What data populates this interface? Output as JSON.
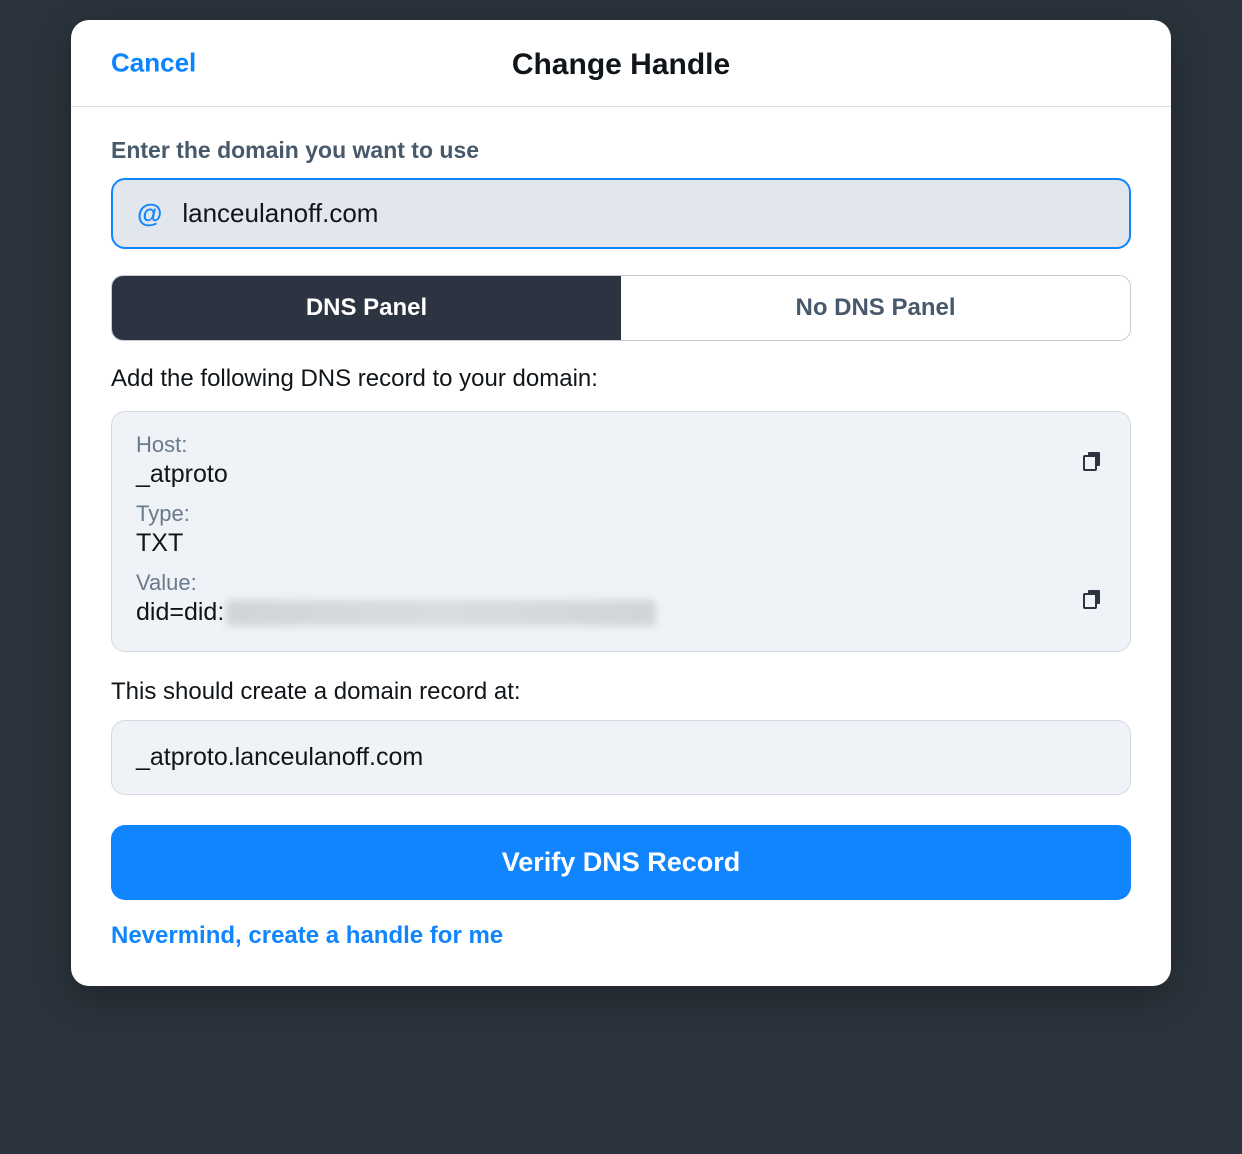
{
  "header": {
    "cancel_label": "Cancel",
    "title": "Change Handle"
  },
  "domain_section": {
    "label": "Enter the domain you want to use",
    "at_symbol": "@",
    "value": "lanceulanoff.com"
  },
  "tabs": {
    "dns_panel": "DNS Panel",
    "no_dns_panel": "No DNS Panel"
  },
  "dns": {
    "instruction": "Add the following DNS record to your domain:",
    "host_label": "Host:",
    "host_value": "_atproto",
    "type_label": "Type:",
    "type_value": "TXT",
    "value_label": "Value:",
    "value_prefix": "did=did:"
  },
  "result": {
    "label": "This should create a domain record at:",
    "value": "_atproto.lanceulanoff.com"
  },
  "actions": {
    "verify_label": "Verify DNS Record",
    "nevermind_label": "Nevermind, create a handle for me"
  }
}
